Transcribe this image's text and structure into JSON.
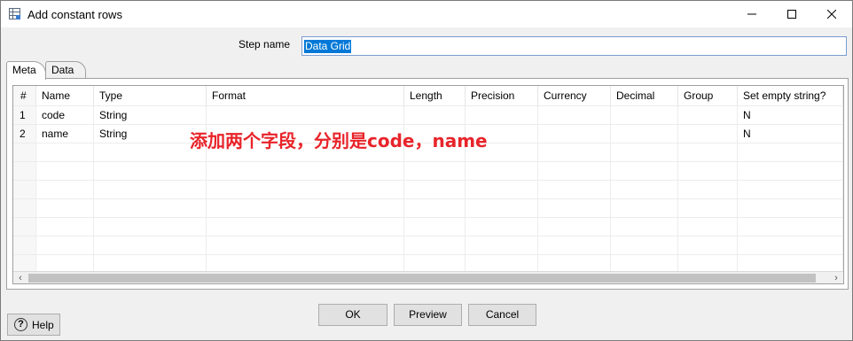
{
  "window": {
    "title": "Add constant rows",
    "icons": {
      "app": "grid-dialog-icon",
      "minimize": "minimize-icon",
      "maximize": "maximize-icon",
      "close": "close-icon"
    }
  },
  "step": {
    "label": "Step name",
    "value": "Data Grid"
  },
  "tabs": [
    {
      "label": "Meta",
      "active": true
    },
    {
      "label": "Data",
      "active": false
    }
  ],
  "grid": {
    "columns": [
      "#",
      "Name",
      "Type",
      "Format",
      "Length",
      "Precision",
      "Currency",
      "Decimal",
      "Group",
      "Set empty string?"
    ],
    "rows": [
      [
        "1",
        "code",
        "String",
        "",
        "",
        "",
        "",
        "",
        "",
        "N"
      ],
      [
        "2",
        "name",
        "String",
        "",
        "",
        "",
        "",
        "",
        "",
        "N"
      ]
    ]
  },
  "annotation": "添加两个字段，分别是code，name",
  "buttons": {
    "ok": "OK",
    "preview": "Preview",
    "cancel": "Cancel",
    "help": "Help"
  },
  "colors": {
    "annotation": "#e8242a",
    "selection": "#0078d7"
  }
}
